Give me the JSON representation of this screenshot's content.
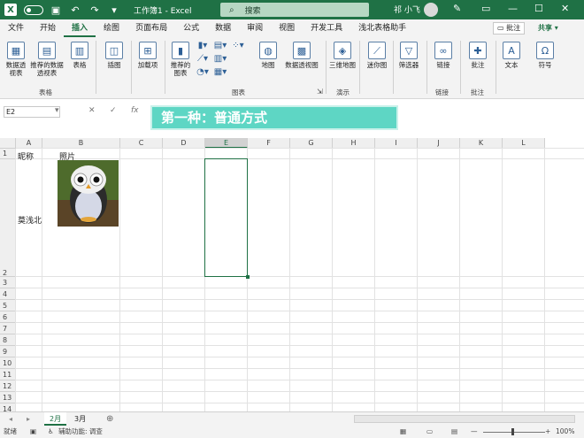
{
  "titlebar": {
    "title": "工作簿1 - Excel",
    "search_placeholder": "搜索",
    "user": "祁 小飞"
  },
  "tabs": [
    "文件",
    "开始",
    "插入",
    "绘图",
    "页面布局",
    "公式",
    "数据",
    "审阅",
    "视图",
    "开发工具",
    "浅北表格助手"
  ],
  "tab_comment": "批注",
  "tab_share": "共享",
  "ribbon": {
    "pivot": "数据透视表",
    "rec_pivot": "推荐的数据透视表",
    "table": "表格",
    "group_tables": "表格",
    "illustrations": "插图",
    "addins": "加载项",
    "rec_charts": "推荐的图表",
    "map": "地图",
    "pivot_chart": "数据透视图",
    "group_charts": "图表",
    "map3d": "三维地图",
    "group_tour": "演示",
    "sparklines": "迷你图",
    "slicer": "筛选器",
    "link": "链接",
    "group_link": "链接",
    "comment": "批注",
    "group_comment": "批注",
    "text": "文本",
    "symbols": "符号"
  },
  "formula": {
    "namebox": "E2",
    "banner": "第一种：普通方式"
  },
  "columns": [
    "A",
    "B",
    "C",
    "D",
    "E",
    "F",
    "G",
    "H",
    "I",
    "J",
    "K",
    "L"
  ],
  "rows": [
    "1",
    "2",
    "3",
    "4",
    "5",
    "6",
    "7",
    "8",
    "9",
    "10",
    "11",
    "12",
    "13",
    "14"
  ],
  "cells": {
    "a1": "昵称",
    "b1": "照片",
    "a2": "莫浅北"
  },
  "sheets": [
    "2月",
    "3月"
  ],
  "status": {
    "ready": "就绪",
    "accessibility": "辅助功能: 调查",
    "zoom": "100%"
  }
}
